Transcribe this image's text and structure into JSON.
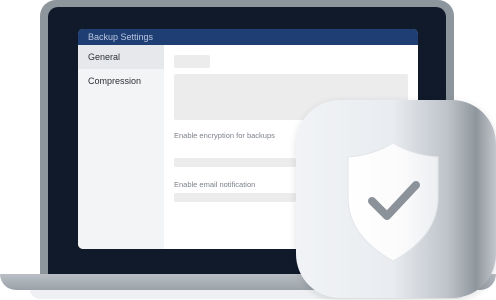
{
  "window": {
    "title": "Backup Settings"
  },
  "sidebar": {
    "items": [
      {
        "label": "General",
        "active": true
      },
      {
        "label": "Compression",
        "active": false
      }
    ]
  },
  "content": {
    "encryption_label": "Enable encryption for backups",
    "email_label": "Enable email notification"
  },
  "badge": {
    "icon": "shield-check-icon"
  },
  "colors": {
    "titlebar": "#1f3e73",
    "screen": "#101a2b",
    "bezel": "#8e969d"
  }
}
